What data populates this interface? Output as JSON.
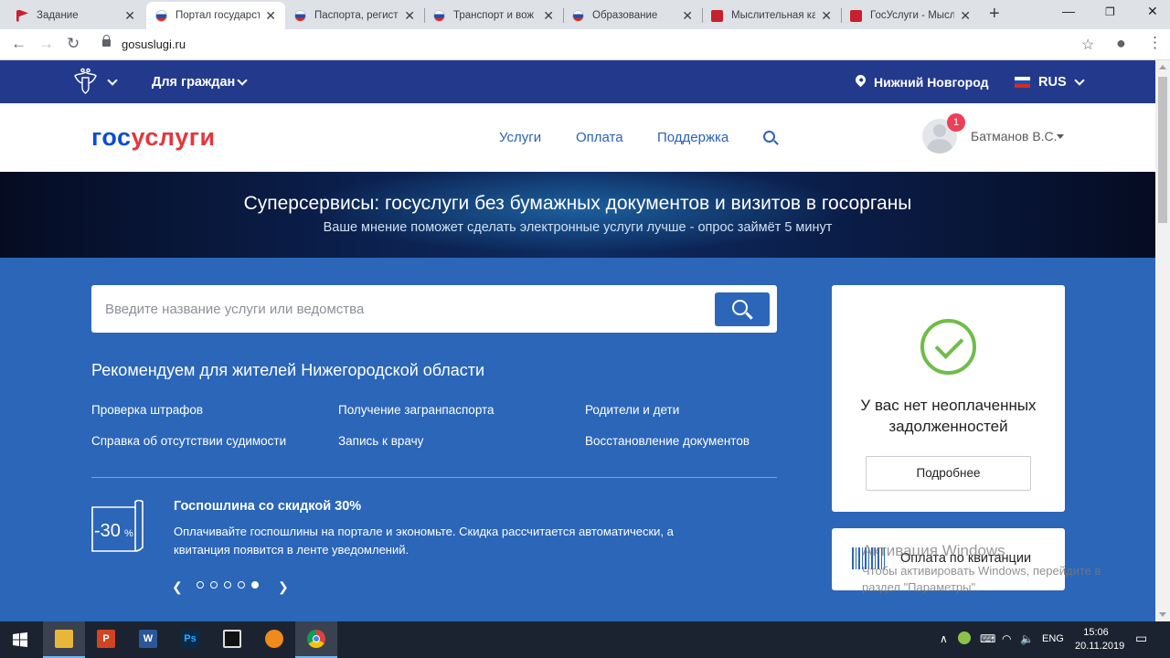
{
  "browser": {
    "tabs": [
      {
        "title": "Задание",
        "icon": "red-flag-favicon"
      },
      {
        "title": "Портал государст",
        "icon": "russia-flag-favicon",
        "active": true
      },
      {
        "title": "Паспорта, регист",
        "icon": "russia-flag-favicon"
      },
      {
        "title": "Транспорт и вож",
        "icon": "russia-flag-favicon"
      },
      {
        "title": "Образование",
        "icon": "russia-flag-favicon"
      },
      {
        "title": "Мыслительная ка",
        "icon": "red-app-favicon"
      },
      {
        "title": "ГосУслуги - Мысл",
        "icon": "red-app-favicon"
      }
    ],
    "url": "gosuslugi.ru"
  },
  "topbar": {
    "for_citizens": "Для граждан",
    "city": "Нижний Новгород",
    "language": "RUS"
  },
  "header": {
    "logo_part1": "гос",
    "logo_part2": "услуги",
    "nav": [
      "Услуги",
      "Оплата",
      "Поддержка"
    ],
    "notification_count": "1",
    "user_name": "Батманов В.С."
  },
  "banner": {
    "title": "Суперсервисы: госуслуги без бумажных документов и визитов в госорганы",
    "subtitle": "Ваше мнение поможет сделать электронные услуги лучше - опрос займёт 5 минут"
  },
  "search": {
    "placeholder": "Введите название услуги или ведомства"
  },
  "recommendations": {
    "title": "Рекомендуем для жителей Нижегородской области",
    "items": [
      "Проверка штрафов",
      "Получение загранпаспорта",
      "Родители и дети",
      "Справка об отсутствии судимости",
      "Запись к врачу",
      "Восстановление документов"
    ]
  },
  "promo": {
    "icon_text": "-30",
    "icon_percent": "%",
    "title": "Госпошлина со скидкой 30%",
    "text": "Оплачивайте госпошлины на портале и экономьте. Скидка рассчитается автоматически, а квитанция появится в ленте уведомлений.",
    "slides_total": 5,
    "active_slide": 5
  },
  "debt_card": {
    "text": "У вас нет неоплаченных задолженностей",
    "button": "Подробнее",
    "check_color": "#6fbd48"
  },
  "receipt_card": {
    "label": "Оплата по квитанции"
  },
  "watermark": {
    "title": "Активация Windows",
    "text": "Чтобы активировать Windows, перейдите в раздел \"Параметры\"."
  },
  "taskbar": {
    "language": "ENG",
    "time": "15:06",
    "date": "20.11.2019"
  },
  "colors": {
    "topbar": "#233a8c",
    "main_bg": "#2b66b8",
    "logo_blue": "#0d4cd3",
    "logo_red": "#e5363c",
    "badge": "#ee3f58"
  }
}
